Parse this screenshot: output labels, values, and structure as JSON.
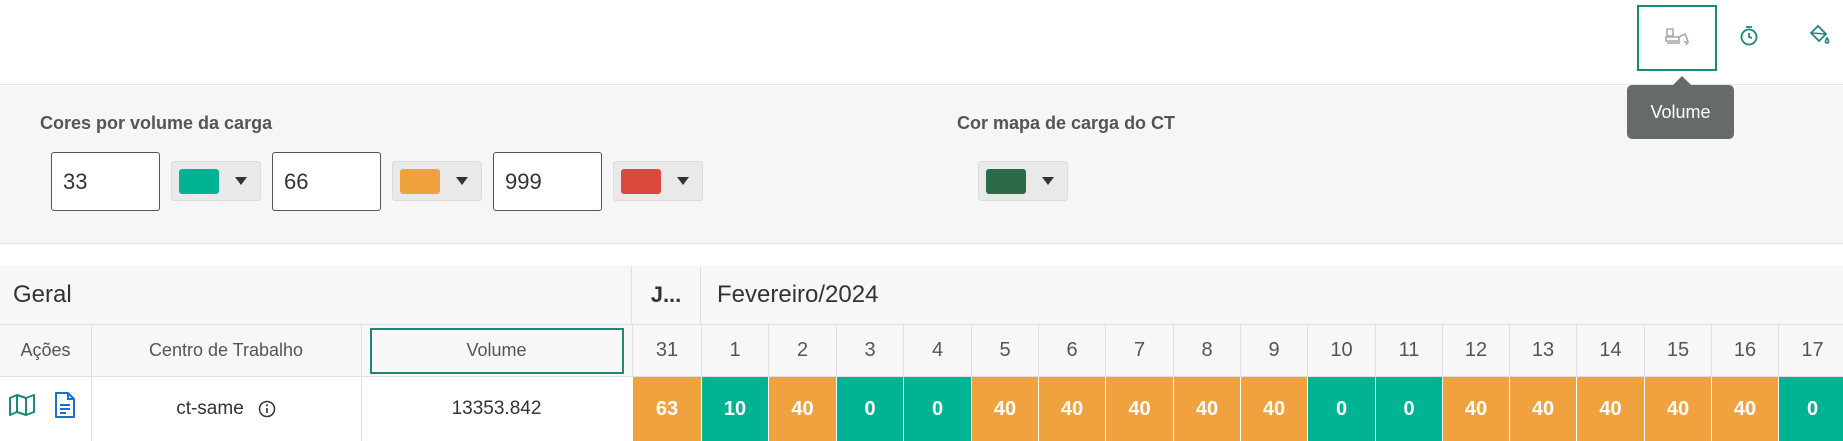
{
  "toolbar": {
    "buttons": [
      {
        "name": "excavator-icon"
      },
      {
        "name": "stopwatch-icon"
      },
      {
        "name": "paint-bucket-icon"
      }
    ],
    "tooltip": "Volume"
  },
  "settings": {
    "volume_colors_label": "Cores por volume da carga",
    "ct_color_label": "Cor mapa de carga do CT",
    "thresholds": [
      {
        "value": "33",
        "color": "#00b392"
      },
      {
        "value": "66",
        "color": "#f0a23e"
      },
      {
        "value": "999",
        "color": "#d9493e"
      }
    ],
    "ct_color": "#2d6a46"
  },
  "grid": {
    "group_general": "Geral",
    "month_prev": "J...",
    "month_current": "Fevereiro/2024",
    "columns": {
      "actions": "Ações",
      "work_center": "Centro de Trabalho",
      "volume": "Volume"
    },
    "row": {
      "work_center": "ct-same",
      "volume": "13353.842"
    },
    "days": [
      "31",
      "1",
      "2",
      "3",
      "4",
      "5",
      "6",
      "7",
      "8",
      "9",
      "10",
      "11",
      "12",
      "13",
      "14",
      "15",
      "16",
      "17"
    ],
    "values": [
      "63",
      "10",
      "40",
      "0",
      "0",
      "40",
      "40",
      "40",
      "40",
      "40",
      "0",
      "0",
      "40",
      "40",
      "40",
      "40",
      "40",
      "0"
    ],
    "colors": {
      "green": "#00b392",
      "orange": "#f0a23e"
    },
    "value_colors": [
      "orange",
      "green",
      "orange",
      "green",
      "green",
      "orange",
      "orange",
      "orange",
      "orange",
      "orange",
      "green",
      "green",
      "orange",
      "orange",
      "orange",
      "orange",
      "orange",
      "green"
    ]
  }
}
